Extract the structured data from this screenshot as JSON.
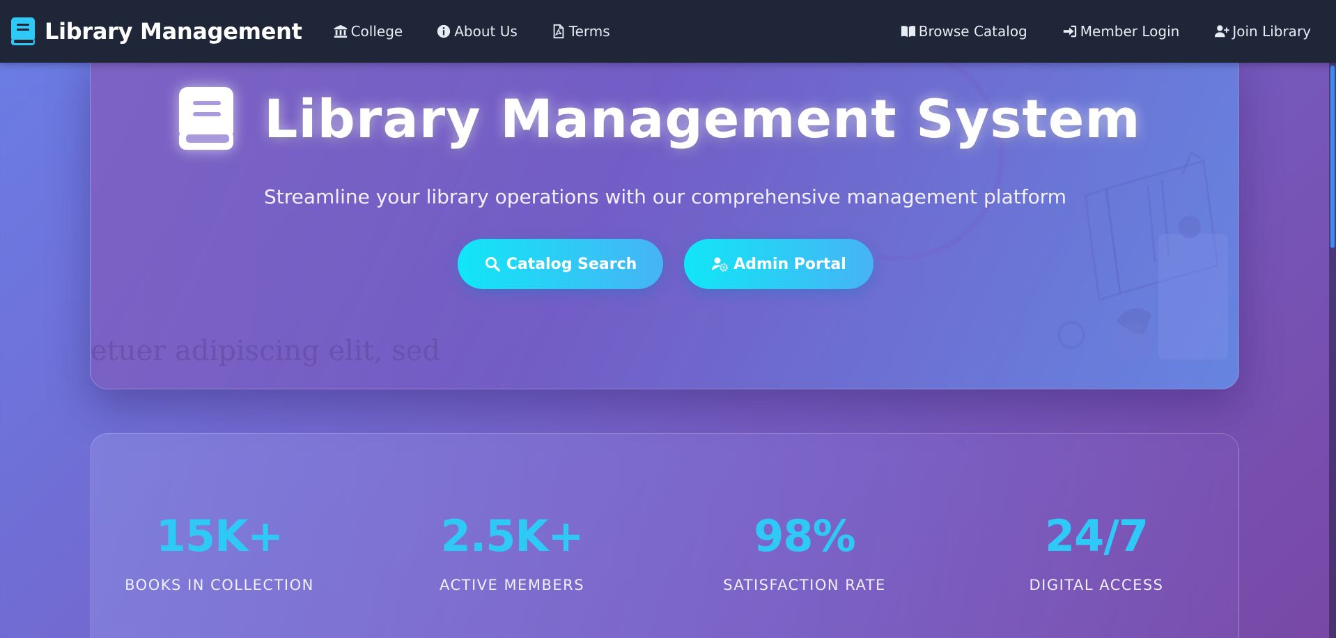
{
  "navbar": {
    "brand": "Library Management",
    "left_links": [
      {
        "label": "College",
        "icon": "building-columns-icon"
      },
      {
        "label": "About Us",
        "icon": "info-circle-icon"
      },
      {
        "label": "Terms",
        "icon": "file-pdf-icon"
      }
    ],
    "right_links": [
      {
        "label": "Browse Catalog",
        "icon": "open-book-icon"
      },
      {
        "label": "Member Login",
        "icon": "sign-in-icon"
      },
      {
        "label": "Join Library",
        "icon": "user-plus-icon"
      }
    ]
  },
  "hero": {
    "title": "Library Management System",
    "subtitle": "Streamline your library operations with our comprehensive management platform",
    "background_text": "etuer adipiscing elit, sed",
    "buttons": [
      {
        "label": "Catalog Search",
        "icon": "search-icon"
      },
      {
        "label": "Admin Portal",
        "icon": "user-gear-icon"
      }
    ]
  },
  "stats": [
    {
      "value": "15K+",
      "label": "BOOKS IN COLLECTION"
    },
    {
      "value": "2.5K+",
      "label": "ACTIVE MEMBERS"
    },
    {
      "value": "98%",
      "label": "SATISFACTION RATE"
    },
    {
      "value": "24/7",
      "label": "DIGITAL ACCESS"
    }
  ],
  "colors": {
    "navbar": "#1f2638",
    "accent_cyan": "#2fc9f7",
    "button_start": "#11e6f6",
    "button_end": "#47b3f5",
    "scroll_thumb": "#3d8df0"
  }
}
